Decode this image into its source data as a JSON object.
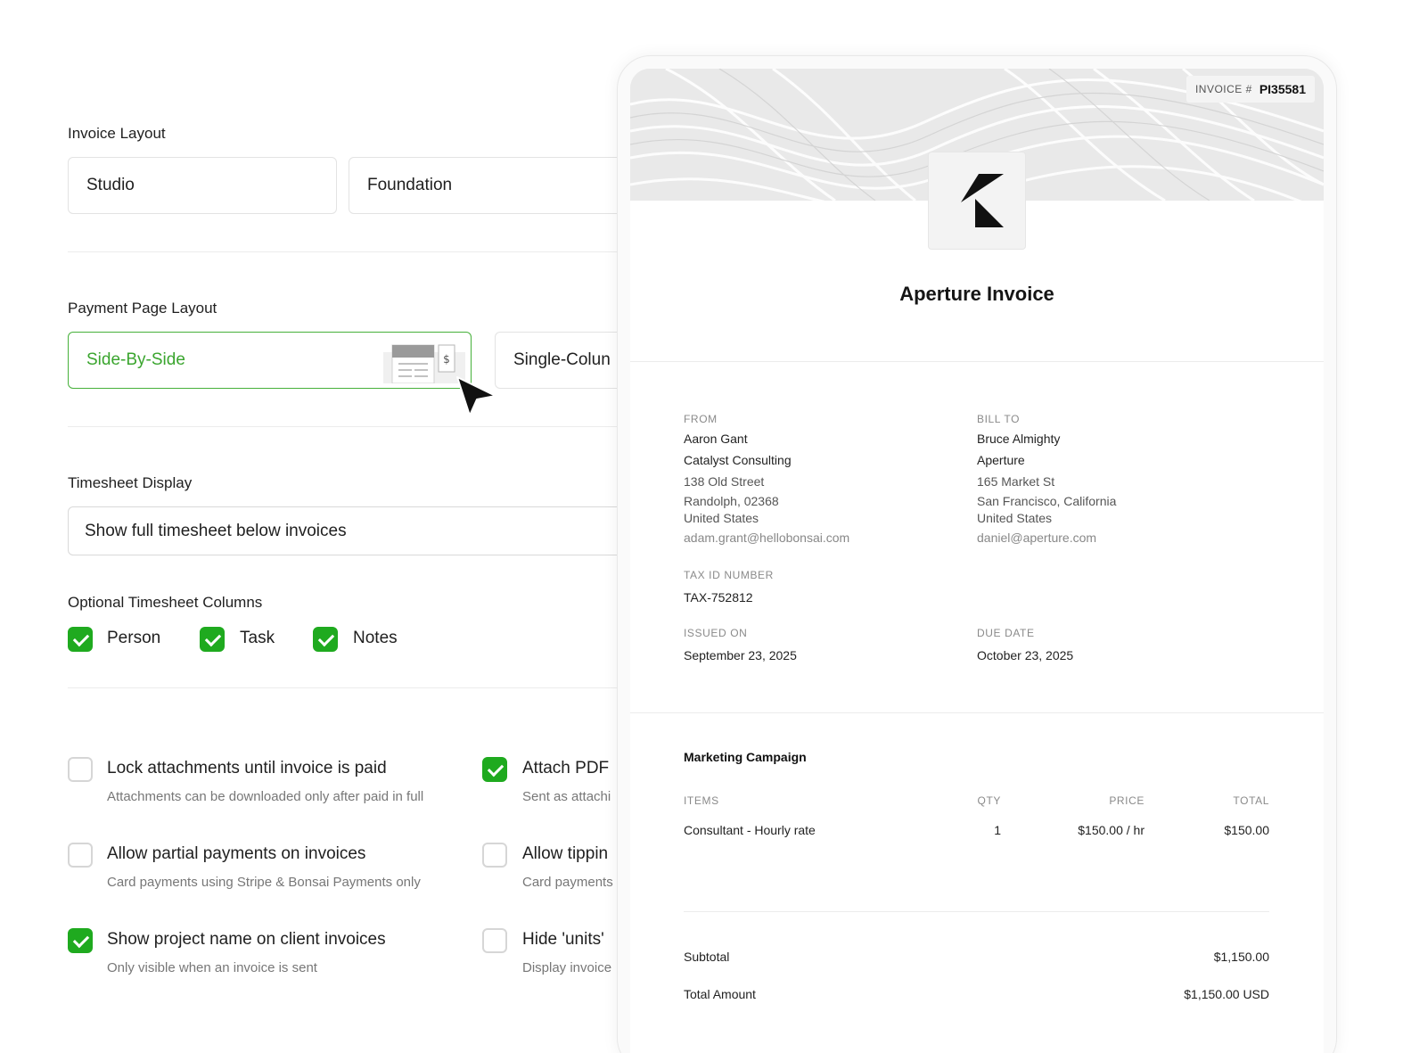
{
  "settings": {
    "invoice_layout": {
      "label": "Invoice Layout",
      "options": [
        "Studio",
        "Foundation"
      ]
    },
    "payment_layout": {
      "label": "Payment Page Layout",
      "options": [
        "Side-By-Side",
        "Single-Colun"
      ],
      "selected": "Side-By-Side"
    },
    "timesheet_display": {
      "label": "Timesheet Display",
      "value": "Show full timesheet below invoices"
    },
    "timesheet_columns": {
      "label": "Optional Timesheet Columns",
      "items": [
        {
          "label": "Person",
          "checked": true
        },
        {
          "label": "Task",
          "checked": true
        },
        {
          "label": "Notes",
          "checked": true
        }
      ]
    },
    "options": [
      {
        "title": "Lock attachments until invoice is paid",
        "desc": "Attachments can be downloaded only after paid in full",
        "checked": false
      },
      {
        "title": "Attach PDF",
        "desc": "Sent as attachi",
        "checked": true
      },
      {
        "title": "Allow partial payments on invoices",
        "desc": "Card payments using Stripe & Bonsai Payments only",
        "checked": false
      },
      {
        "title": "Allow tippin",
        "desc": "Card payments",
        "checked": false
      },
      {
        "title": "Show project name on client invoices",
        "desc": "Only visible when an invoice is sent",
        "checked": true
      },
      {
        "title": "Hide 'units'",
        "desc": "Display invoice",
        "checked": false
      }
    ],
    "mini_icon_symbol": "$"
  },
  "invoice": {
    "number_label": "INVOICE #",
    "number": "PI35581",
    "title": "Aperture Invoice",
    "from": {
      "caption": "FROM",
      "name": "Aaron Gant",
      "company": "Catalyst Consulting",
      "street": "138 Old Street",
      "city": "Randolph, 02368",
      "country": "United States",
      "email": "adam.grant@hellobonsai.com"
    },
    "bill_to": {
      "caption": "BILL TO",
      "name": "Bruce Almighty",
      "company": "Aperture",
      "street": "165 Market St",
      "city": "San Francisco, California",
      "country": "United States",
      "email": "daniel@aperture.com"
    },
    "tax": {
      "caption": "TAX ID NUMBER",
      "value": "TAX-752812"
    },
    "issued": {
      "caption": "ISSUED ON",
      "value": "September 23, 2025"
    },
    "due": {
      "caption": "DUE DATE",
      "value": "October 23, 2025"
    },
    "project": "Marketing Campaign",
    "columns": {
      "items": "ITEMS",
      "qty": "QTY",
      "price": "PRICE",
      "total": "TOTAL"
    },
    "rows": [
      {
        "item": "Consultant - Hourly rate",
        "qty": "1",
        "price": "$150.00 / hr",
        "total": "$150.00"
      }
    ],
    "subtotal_label": "Subtotal",
    "subtotal": "$1,150.00",
    "total_label": "Total Amount",
    "total": "$1,150.00 USD"
  },
  "colors": {
    "accent_green": "#1faa1f",
    "selected_text": "#3aa52e"
  }
}
